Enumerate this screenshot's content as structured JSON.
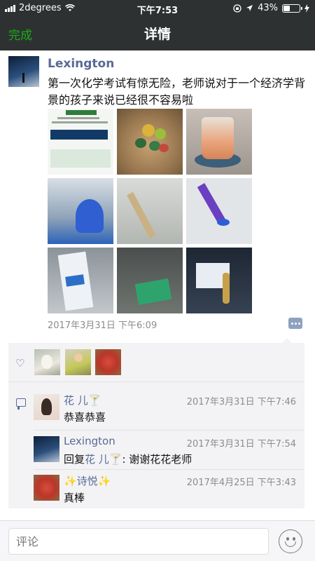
{
  "status_bar": {
    "carrier": "2degrees",
    "time": "下午7:53",
    "battery": "43%",
    "battery_level": 0.43
  },
  "nav": {
    "done_label": "完成",
    "title": "详情"
  },
  "post": {
    "author": "Lexington",
    "text": "第一次化学考试有惊无险，老师说对于一个经济学背景的孩子来说已经很不容易啦",
    "timestamp": "2017年3月31日 下午6:09",
    "photo_count": 9,
    "photo1_text": {
      "heading": "Summary of your previous attempts"
    }
  },
  "likes": {
    "count": 3
  },
  "comments": [
    {
      "name": "花 儿🍸",
      "time": "2017年3月31日 下午7:46",
      "text": "恭喜恭喜"
    },
    {
      "name": "Lexington",
      "time": "2017年3月31日 下午7:54",
      "reply_prefix": "回复",
      "reply_to": "花 儿🍸",
      "text": ": 谢谢花花老师"
    },
    {
      "name": "✨诗悦✨",
      "time": "2017年4月25日 下午3:43",
      "text": "真棒"
    }
  ],
  "input": {
    "placeholder": "评论"
  }
}
